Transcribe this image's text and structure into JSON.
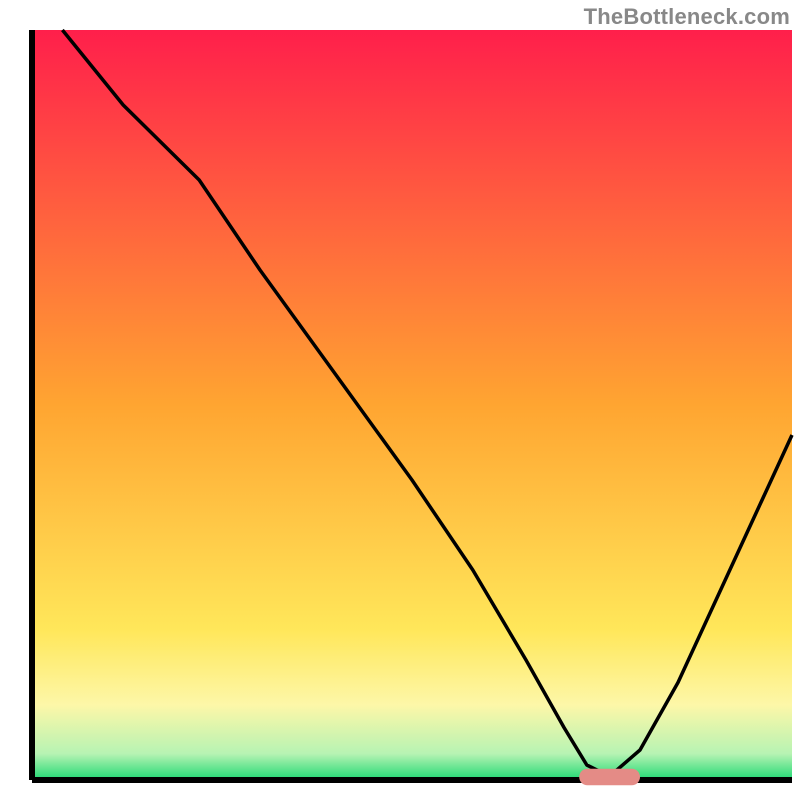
{
  "watermark": "TheBottleneck.com",
  "chart_data": {
    "type": "line",
    "title": "",
    "xlabel": "",
    "ylabel": "",
    "xlim": [
      0,
      100
    ],
    "ylim": [
      0,
      100
    ],
    "axes": {
      "left": true,
      "bottom": true,
      "right": false,
      "top": false,
      "grid": false
    },
    "background_gradient_stops": [
      {
        "offset": 0.0,
        "color": "#ff1f4b"
      },
      {
        "offset": 0.5,
        "color": "#ffa531"
      },
      {
        "offset": 0.8,
        "color": "#ffe75a"
      },
      {
        "offset": 0.9,
        "color": "#fdf7a8"
      },
      {
        "offset": 0.965,
        "color": "#b7f3b3"
      },
      {
        "offset": 1.0,
        "color": "#1fd873"
      }
    ],
    "series": [
      {
        "name": "bottleneck-curve",
        "color": "#000000",
        "x": [
          4,
          12,
          22,
          30,
          40,
          50,
          58,
          65,
          70,
          73,
          76,
          80,
          85,
          90,
          95,
          100
        ],
        "y": [
          100,
          90,
          80,
          68,
          54,
          40,
          28,
          16,
          7,
          2,
          0.5,
          4,
          13,
          24,
          35,
          46
        ]
      }
    ],
    "marker": {
      "name": "optimal-range",
      "color": "#e48b86",
      "x": [
        72,
        80
      ],
      "y": 0.4,
      "thickness": 2.2
    }
  }
}
